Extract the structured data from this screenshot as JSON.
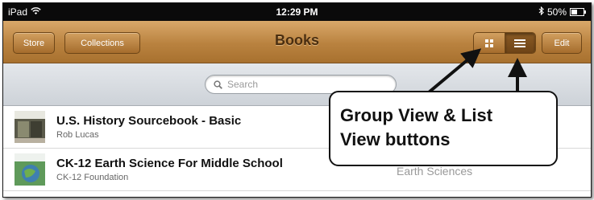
{
  "status_bar": {
    "device": "iPad",
    "time": "12:29 PM",
    "battery": "50%",
    "battery_level": 0.5
  },
  "nav": {
    "title": "Books",
    "store_label": "Store",
    "collections_label": "Collections",
    "edit_label": "Edit"
  },
  "search": {
    "placeholder": "Search"
  },
  "books": [
    {
      "title": "U.S. History Sourcebook - Basic",
      "author": "Rob Lucas",
      "genre": ""
    },
    {
      "title": "CK-12 Earth Science For Middle School",
      "author": "CK-12 Foundation",
      "genre": "Earth Sciences"
    }
  ],
  "annotation": {
    "line1": "Group View & List",
    "line2": "View buttons"
  },
  "colors": {
    "nav_brown": "#b9823f",
    "title_brown": "#4a2e10",
    "status_black": "#0a0a0a"
  },
  "icons": {
    "wifi": "wifi-icon",
    "bluetooth": "bluetooth-icon",
    "battery": "battery-icon",
    "search": "search-icon",
    "grid_view": "grid-view-icon",
    "list_view": "list-view-icon"
  }
}
